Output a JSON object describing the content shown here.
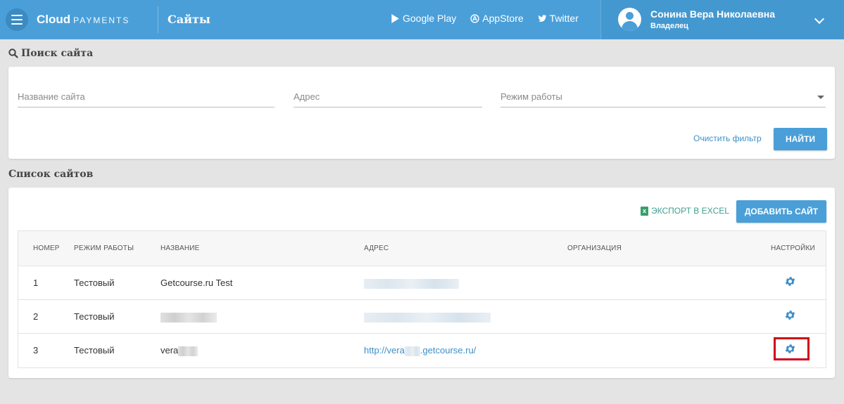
{
  "header": {
    "brand_main": "Cloud",
    "brand_sub": "PAYMENTS",
    "page_title": "Сайты",
    "links": [
      {
        "label": "Google Play",
        "icon": "play-icon"
      },
      {
        "label": "AppStore",
        "icon": "appstore-icon"
      },
      {
        "label": "Twitter",
        "icon": "twitter-icon"
      }
    ],
    "user_name": "Сонина Вера Николаевна",
    "user_role": "Владелец"
  },
  "search": {
    "title": "Поиск сайта",
    "name_placeholder": "Название сайта",
    "address_placeholder": "Адрес",
    "mode_placeholder": "Режим работы",
    "clear_label": "Очистить фильтр",
    "find_label": "НАЙТИ"
  },
  "sites": {
    "title": "Список сайтов",
    "export_label": "ЭКСПОРТ В EXCEL",
    "add_label": "ДОБАВИТЬ САЙТ",
    "columns": [
      "НОМЕР",
      "РЕЖИМ РАБОТЫ",
      "НАЗВАНИЕ",
      "АДРЕС",
      "ОРГАНИЗАЦИЯ",
      "НАСТРОЙКИ"
    ],
    "rows": [
      {
        "number": "1",
        "mode": "Тестовый",
        "name": "Getcourse.ru Test",
        "address": "",
        "organization": ""
      },
      {
        "number": "2",
        "mode": "Тестовый",
        "name": "",
        "address": "",
        "organization": ""
      },
      {
        "number": "3",
        "mode": "Тестовый",
        "name": "vera",
        "address_start": "http://vera",
        "address_end": ".getcourse.ru/",
        "organization": ""
      }
    ]
  },
  "colors": {
    "accent": "#4a9fd8",
    "link": "#3d8fc9",
    "highlight": "#d0021b"
  }
}
